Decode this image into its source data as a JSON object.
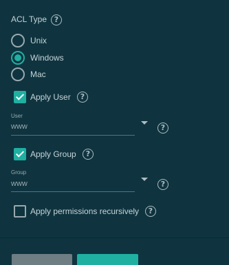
{
  "acl_type": {
    "label": "ACL Type",
    "options": [
      {
        "label": "Unix",
        "selected": false
      },
      {
        "label": "Windows",
        "selected": true
      },
      {
        "label": "Mac",
        "selected": false
      }
    ]
  },
  "apply_user": {
    "label": "Apply User",
    "checked": true
  },
  "user_field": {
    "caption": "User",
    "value": "www"
  },
  "apply_group": {
    "label": "Apply Group",
    "checked": true
  },
  "group_field": {
    "caption": "Group",
    "value": "www"
  },
  "recursive": {
    "label": "Apply permissions recursively",
    "checked": false
  },
  "icons": {
    "help": "help-icon",
    "dropdown": "chevron-down-icon"
  },
  "colors": {
    "background": "#0f3440",
    "accent": "#1fb0a2",
    "cancel_button": "#6e7e83"
  }
}
